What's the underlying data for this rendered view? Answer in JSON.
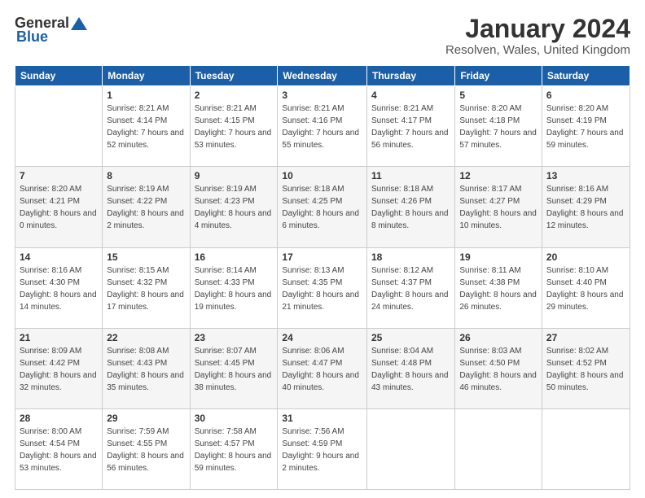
{
  "logo": {
    "general": "General",
    "blue": "Blue"
  },
  "header": {
    "month": "January 2024",
    "location": "Resolven, Wales, United Kingdom"
  },
  "days_of_week": [
    "Sunday",
    "Monday",
    "Tuesday",
    "Wednesday",
    "Thursday",
    "Friday",
    "Saturday"
  ],
  "weeks": [
    [
      {
        "day": "",
        "sunrise": "",
        "sunset": "",
        "daylight": ""
      },
      {
        "day": "1",
        "sunrise": "Sunrise: 8:21 AM",
        "sunset": "Sunset: 4:14 PM",
        "daylight": "Daylight: 7 hours and 52 minutes."
      },
      {
        "day": "2",
        "sunrise": "Sunrise: 8:21 AM",
        "sunset": "Sunset: 4:15 PM",
        "daylight": "Daylight: 7 hours and 53 minutes."
      },
      {
        "day": "3",
        "sunrise": "Sunrise: 8:21 AM",
        "sunset": "Sunset: 4:16 PM",
        "daylight": "Daylight: 7 hours and 55 minutes."
      },
      {
        "day": "4",
        "sunrise": "Sunrise: 8:21 AM",
        "sunset": "Sunset: 4:17 PM",
        "daylight": "Daylight: 7 hours and 56 minutes."
      },
      {
        "day": "5",
        "sunrise": "Sunrise: 8:20 AM",
        "sunset": "Sunset: 4:18 PM",
        "daylight": "Daylight: 7 hours and 57 minutes."
      },
      {
        "day": "6",
        "sunrise": "Sunrise: 8:20 AM",
        "sunset": "Sunset: 4:19 PM",
        "daylight": "Daylight: 7 hours and 59 minutes."
      }
    ],
    [
      {
        "day": "7",
        "sunrise": "Sunrise: 8:20 AM",
        "sunset": "Sunset: 4:21 PM",
        "daylight": "Daylight: 8 hours and 0 minutes."
      },
      {
        "day": "8",
        "sunrise": "Sunrise: 8:19 AM",
        "sunset": "Sunset: 4:22 PM",
        "daylight": "Daylight: 8 hours and 2 minutes."
      },
      {
        "day": "9",
        "sunrise": "Sunrise: 8:19 AM",
        "sunset": "Sunset: 4:23 PM",
        "daylight": "Daylight: 8 hours and 4 minutes."
      },
      {
        "day": "10",
        "sunrise": "Sunrise: 8:18 AM",
        "sunset": "Sunset: 4:25 PM",
        "daylight": "Daylight: 8 hours and 6 minutes."
      },
      {
        "day": "11",
        "sunrise": "Sunrise: 8:18 AM",
        "sunset": "Sunset: 4:26 PM",
        "daylight": "Daylight: 8 hours and 8 minutes."
      },
      {
        "day": "12",
        "sunrise": "Sunrise: 8:17 AM",
        "sunset": "Sunset: 4:27 PM",
        "daylight": "Daylight: 8 hours and 10 minutes."
      },
      {
        "day": "13",
        "sunrise": "Sunrise: 8:16 AM",
        "sunset": "Sunset: 4:29 PM",
        "daylight": "Daylight: 8 hours and 12 minutes."
      }
    ],
    [
      {
        "day": "14",
        "sunrise": "Sunrise: 8:16 AM",
        "sunset": "Sunset: 4:30 PM",
        "daylight": "Daylight: 8 hours and 14 minutes."
      },
      {
        "day": "15",
        "sunrise": "Sunrise: 8:15 AM",
        "sunset": "Sunset: 4:32 PM",
        "daylight": "Daylight: 8 hours and 17 minutes."
      },
      {
        "day": "16",
        "sunrise": "Sunrise: 8:14 AM",
        "sunset": "Sunset: 4:33 PM",
        "daylight": "Daylight: 8 hours and 19 minutes."
      },
      {
        "day": "17",
        "sunrise": "Sunrise: 8:13 AM",
        "sunset": "Sunset: 4:35 PM",
        "daylight": "Daylight: 8 hours and 21 minutes."
      },
      {
        "day": "18",
        "sunrise": "Sunrise: 8:12 AM",
        "sunset": "Sunset: 4:37 PM",
        "daylight": "Daylight: 8 hours and 24 minutes."
      },
      {
        "day": "19",
        "sunrise": "Sunrise: 8:11 AM",
        "sunset": "Sunset: 4:38 PM",
        "daylight": "Daylight: 8 hours and 26 minutes."
      },
      {
        "day": "20",
        "sunrise": "Sunrise: 8:10 AM",
        "sunset": "Sunset: 4:40 PM",
        "daylight": "Daylight: 8 hours and 29 minutes."
      }
    ],
    [
      {
        "day": "21",
        "sunrise": "Sunrise: 8:09 AM",
        "sunset": "Sunset: 4:42 PM",
        "daylight": "Daylight: 8 hours and 32 minutes."
      },
      {
        "day": "22",
        "sunrise": "Sunrise: 8:08 AM",
        "sunset": "Sunset: 4:43 PM",
        "daylight": "Daylight: 8 hours and 35 minutes."
      },
      {
        "day": "23",
        "sunrise": "Sunrise: 8:07 AM",
        "sunset": "Sunset: 4:45 PM",
        "daylight": "Daylight: 8 hours and 38 minutes."
      },
      {
        "day": "24",
        "sunrise": "Sunrise: 8:06 AM",
        "sunset": "Sunset: 4:47 PM",
        "daylight": "Daylight: 8 hours and 40 minutes."
      },
      {
        "day": "25",
        "sunrise": "Sunrise: 8:04 AM",
        "sunset": "Sunset: 4:48 PM",
        "daylight": "Daylight: 8 hours and 43 minutes."
      },
      {
        "day": "26",
        "sunrise": "Sunrise: 8:03 AM",
        "sunset": "Sunset: 4:50 PM",
        "daylight": "Daylight: 8 hours and 46 minutes."
      },
      {
        "day": "27",
        "sunrise": "Sunrise: 8:02 AM",
        "sunset": "Sunset: 4:52 PM",
        "daylight": "Daylight: 8 hours and 50 minutes."
      }
    ],
    [
      {
        "day": "28",
        "sunrise": "Sunrise: 8:00 AM",
        "sunset": "Sunset: 4:54 PM",
        "daylight": "Daylight: 8 hours and 53 minutes."
      },
      {
        "day": "29",
        "sunrise": "Sunrise: 7:59 AM",
        "sunset": "Sunset: 4:55 PM",
        "daylight": "Daylight: 8 hours and 56 minutes."
      },
      {
        "day": "30",
        "sunrise": "Sunrise: 7:58 AM",
        "sunset": "Sunset: 4:57 PM",
        "daylight": "Daylight: 8 hours and 59 minutes."
      },
      {
        "day": "31",
        "sunrise": "Sunrise: 7:56 AM",
        "sunset": "Sunset: 4:59 PM",
        "daylight": "Daylight: 9 hours and 2 minutes."
      },
      {
        "day": "",
        "sunrise": "",
        "sunset": "",
        "daylight": ""
      },
      {
        "day": "",
        "sunrise": "",
        "sunset": "",
        "daylight": ""
      },
      {
        "day": "",
        "sunrise": "",
        "sunset": "",
        "daylight": ""
      }
    ]
  ]
}
